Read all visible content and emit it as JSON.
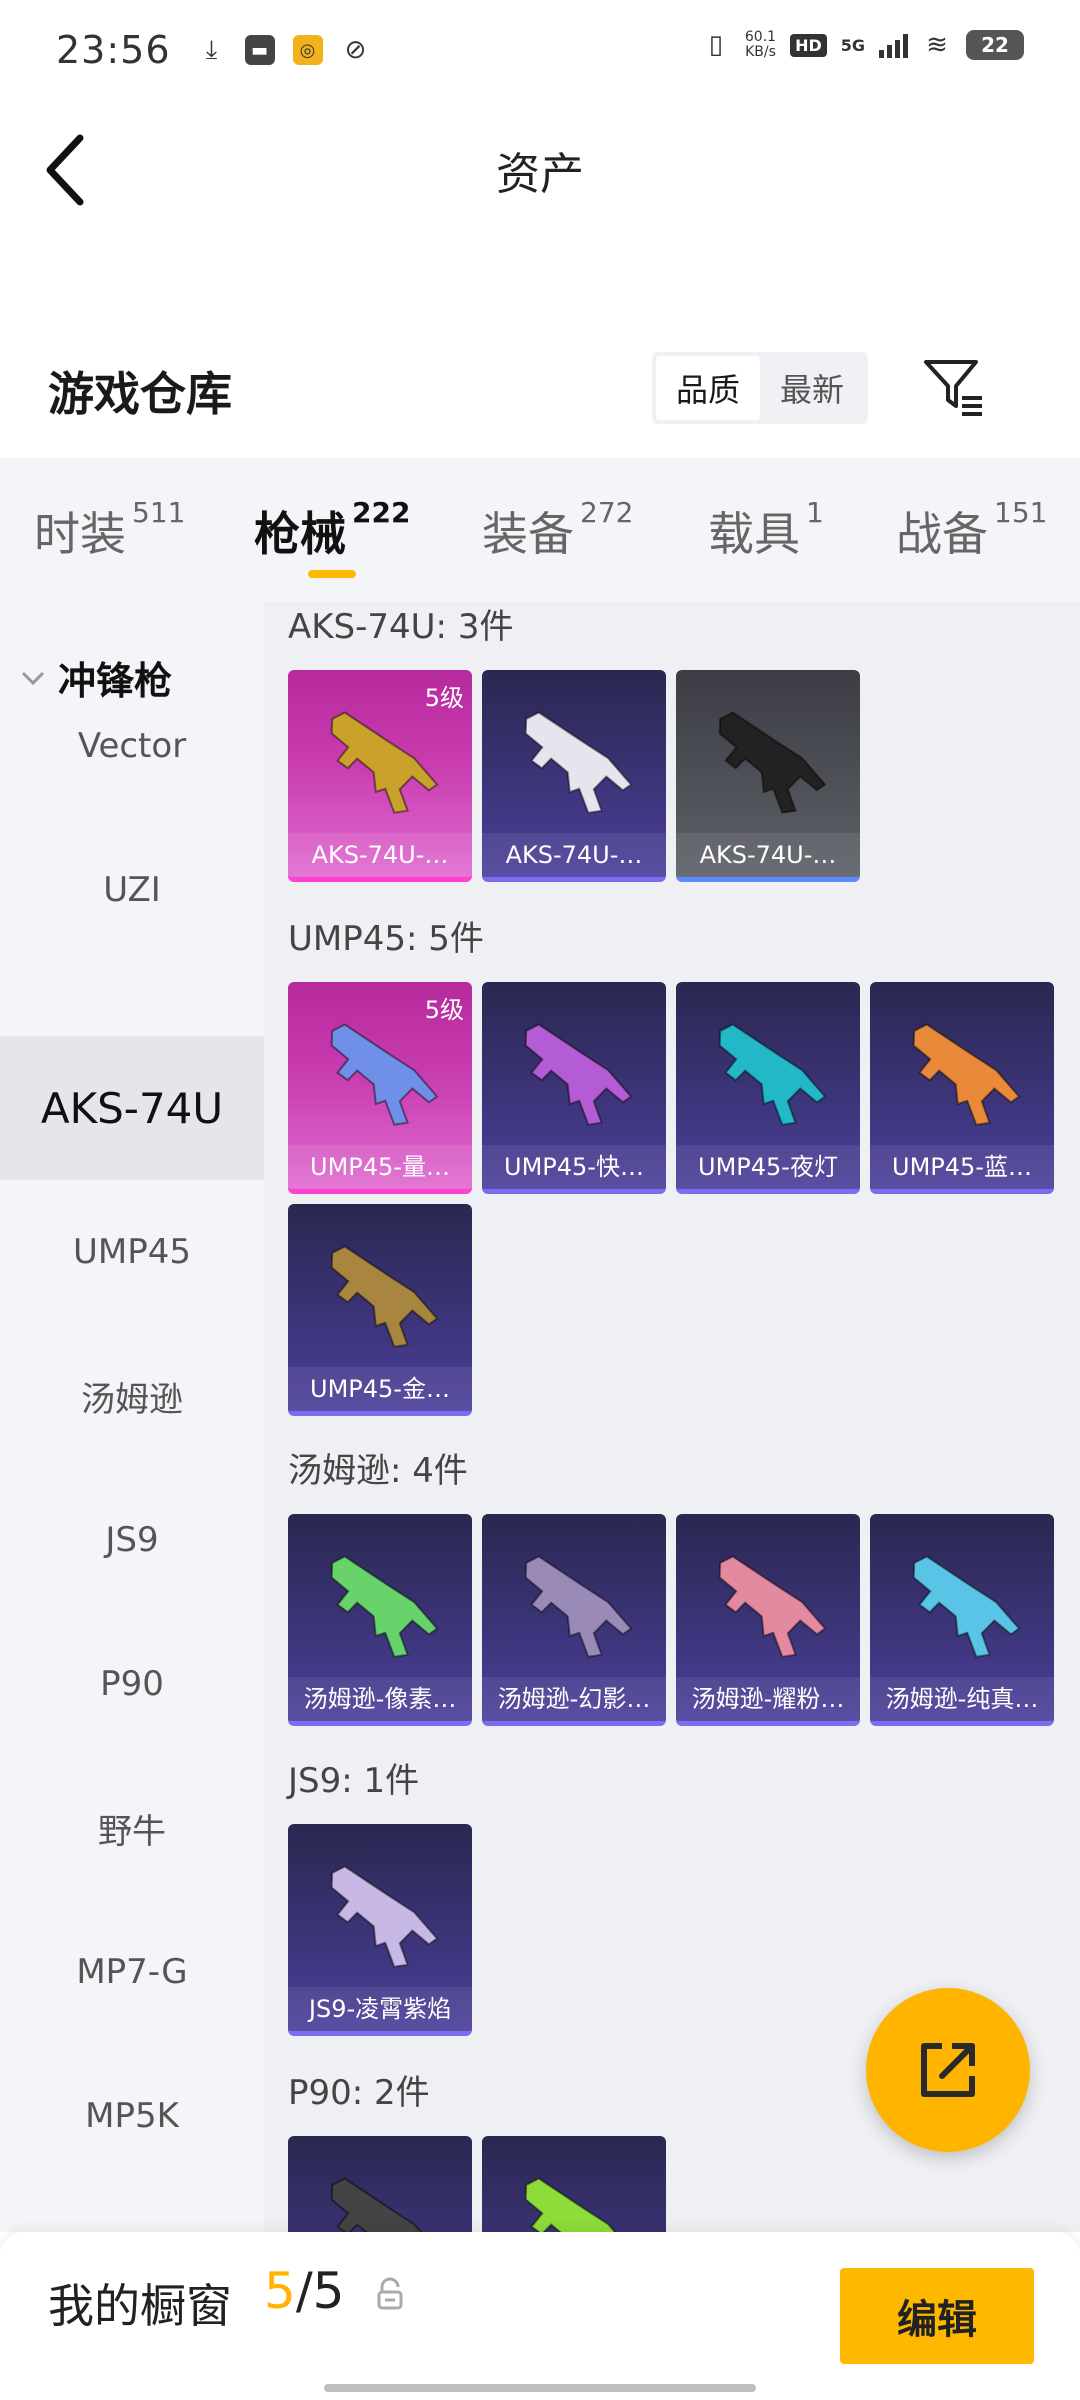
{
  "status_bar": {
    "time": "23:56",
    "speed_top": "60.1",
    "speed_unit": "KB/s",
    "hd": "HD",
    "net": "5G",
    "battery": "22"
  },
  "header": {
    "title": "资产"
  },
  "warehouse": {
    "title": "游戏仓库",
    "sort_options": [
      "品质",
      "最新"
    ]
  },
  "tabs": [
    {
      "label": "时装",
      "count": "511"
    },
    {
      "label": "枪械",
      "count": "222"
    },
    {
      "label": "装备",
      "count": "272"
    },
    {
      "label": "载具",
      "count": "1"
    },
    {
      "label": "战备",
      "count": "151"
    }
  ],
  "sidenav": {
    "group": "冲锋枪",
    "items": [
      "Vector",
      "UZI",
      "AKS-74U",
      "UMP45",
      "汤姆逊",
      "JS9",
      "P90",
      "野牛",
      "MP7-G",
      "MP5K"
    ],
    "active": "AKS-74U"
  },
  "groups": [
    {
      "label": "AKS-74U: 3件",
      "cards": [
        {
          "name": "AKS-74U-…",
          "level": "5级",
          "style": "gold",
          "gun": "#c9a12b"
        },
        {
          "name": "AKS-74U-…",
          "level": "",
          "style": "purple",
          "gun": "#e8e4ee"
        },
        {
          "name": "AKS-74U-…",
          "level": "",
          "style": "grey",
          "gun": "#222222"
        }
      ]
    },
    {
      "label": "UMP45: 5件",
      "cards": [
        {
          "name": "UMP45-量…",
          "level": "5级",
          "style": "gold",
          "gun": "#6f8fe8"
        },
        {
          "name": "UMP45-快…",
          "level": "",
          "style": "purple",
          "gun": "#b45bd6"
        },
        {
          "name": "UMP45-夜灯",
          "level": "",
          "style": "purple",
          "gun": "#22b8c8"
        },
        {
          "name": "UMP45-蓝…",
          "level": "",
          "style": "purple",
          "gun": "#e88a3a"
        },
        {
          "name": "UMP45-金…",
          "level": "",
          "style": "purple",
          "gun": "#a88640"
        }
      ]
    },
    {
      "label": "汤姆逊: 4件",
      "cards": [
        {
          "name": "汤姆逊-像素…",
          "level": "",
          "style": "purple",
          "gun": "#68d36a"
        },
        {
          "name": "汤姆逊-幻影…",
          "level": "",
          "style": "purple",
          "gun": "#9a8ab8"
        },
        {
          "name": "汤姆逊-耀粉…",
          "level": "",
          "style": "purple",
          "gun": "#e38aa0"
        },
        {
          "name": "汤姆逊-纯真…",
          "level": "",
          "style": "purple",
          "gun": "#5ac4e6"
        }
      ]
    },
    {
      "label": "JS9: 1件",
      "cards": [
        {
          "name": "JS9-凌霄紫焰",
          "level": "",
          "style": "purple",
          "gun": "#c8b8e6"
        }
      ]
    },
    {
      "label": "P90: 2件",
      "cards": [
        {
          "name": "",
          "level": "",
          "style": "purple",
          "gun": "#444444"
        },
        {
          "name": "",
          "level": "",
          "style": "purple",
          "gun": "#8ddc3a"
        }
      ]
    }
  ],
  "bottom_bar": {
    "label": "我的橱窗",
    "current": "5",
    "total": "/5",
    "edit_label": "编辑"
  },
  "colors": {
    "accent": "#ffb800",
    "legendary": "#c83cb0",
    "epic": "#4b3f9a"
  },
  "icons": [
    "back-arrow-icon",
    "filter-icon",
    "chevron-down-icon",
    "share-external-icon",
    "lock-icon"
  ]
}
